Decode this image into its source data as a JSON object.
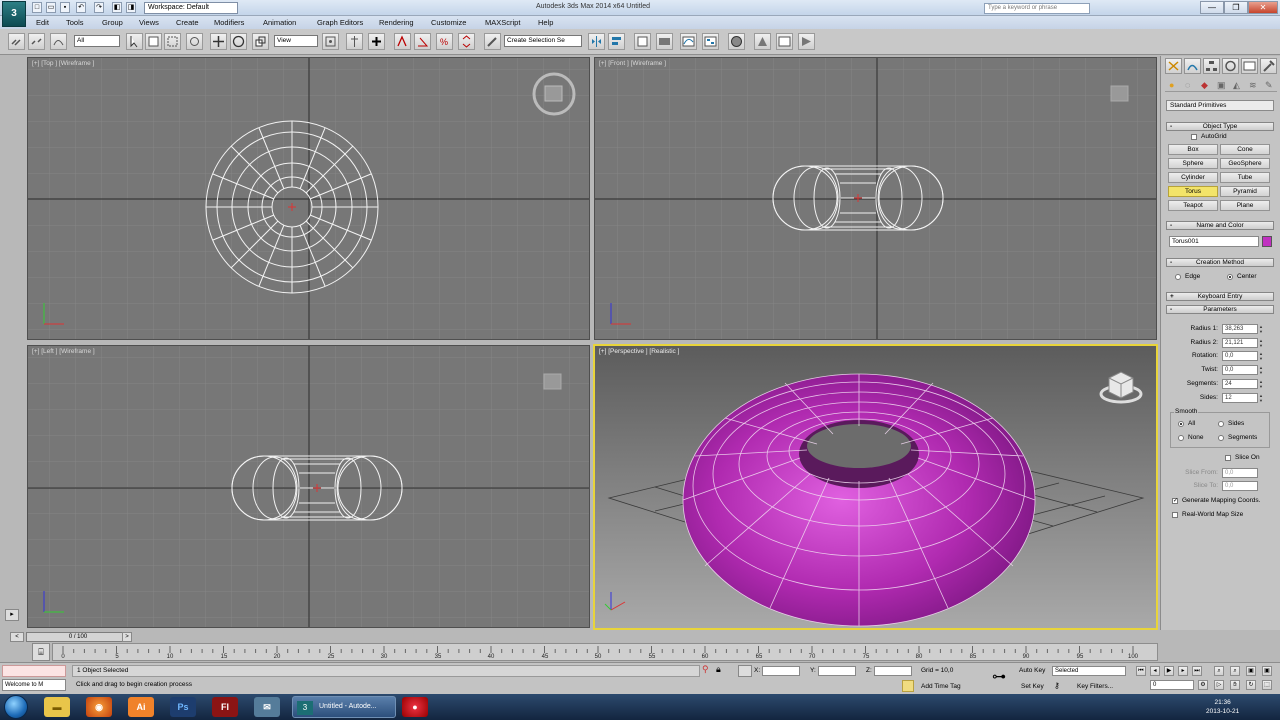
{
  "titlebar": {
    "logo_text": "3",
    "workspace": "Workspace: Default",
    "app_title": "Autodesk 3ds Max  2014 x64     Untitled",
    "search_placeholder": "Type a keyword or phrase",
    "minimize": "—",
    "restore": "❐",
    "close": "✕"
  },
  "menu": [
    "Edit",
    "Tools",
    "Group",
    "Views",
    "Create",
    "Modifiers",
    "Animation",
    "Graph Editors",
    "Rendering",
    "Customize",
    "MAXScript",
    "Help"
  ],
  "toolbar": {
    "filter_select": "All",
    "coord_select": "View",
    "selection_set": "Create Selection Se"
  },
  "viewports": {
    "top": "[+] [Top ] [Wireframe ]",
    "front": "[+] [Front ] [Wireframe ]",
    "left": "[+] [Left ] [Wireframe ]",
    "perspective": "[+] [Perspective ] [Realistic ]"
  },
  "command_panel": {
    "category_select": "Standard Primitives",
    "object_type_title": "Object Type",
    "autogrid": "AutoGrid",
    "objects": [
      "Box",
      "Cone",
      "Sphere",
      "GeoSphere",
      "Cylinder",
      "Tube",
      "Torus",
      "Pyramid",
      "Teapot",
      "Plane"
    ],
    "active_object": "Torus",
    "name_color_title": "Name and Color",
    "object_name": "Torus001",
    "object_color": "#c030c0",
    "creation_method_title": "Creation Method",
    "creation_edge": "Edge",
    "creation_center": "Center",
    "keyboard_entry_title": "Keyboard Entry",
    "parameters_title": "Parameters",
    "params": [
      {
        "label": "Radius 1:",
        "value": "38,263"
      },
      {
        "label": "Radius 2:",
        "value": "21,121"
      },
      {
        "label": "Rotation:",
        "value": "0,0"
      },
      {
        "label": "Twist:",
        "value": "0,0"
      },
      {
        "label": "Segments:",
        "value": "24"
      },
      {
        "label": "Sides:",
        "value": "12"
      }
    ],
    "smooth_title": "Smooth",
    "smooth_all": "All",
    "smooth_sides": "Sides",
    "smooth_none": "None",
    "smooth_segments": "Segments",
    "slice_on": "Slice On",
    "slice_from": "Slice From:",
    "slice_to": "Slice To:",
    "slice_from_value": "0,0",
    "slice_to_value": "0,0",
    "gen_mapping": "Generate Mapping Coords.",
    "real_world": "Real-World Map Size"
  },
  "timeline": {
    "slider": "0 / 100",
    "ticks": [
      "0",
      "5",
      "10",
      "15",
      "20",
      "25",
      "30",
      "35",
      "40",
      "45",
      "50",
      "55",
      "60",
      "65",
      "70",
      "75",
      "80",
      "85",
      "90",
      "95",
      "100"
    ]
  },
  "status": {
    "maxscript": "Welcome to M",
    "selected": "1 Object Selected",
    "prompt": "Click and drag to begin creation process",
    "x_label": "X:",
    "y_label": "Y:",
    "z_label": "Z:",
    "grid": "Grid = 10,0",
    "add_time_tag": "Add Time Tag",
    "auto_key": "Auto Key",
    "set_key": "Set Key",
    "key_mode": "Selected",
    "key_filters": "Key Filters...",
    "frame": "0"
  },
  "taskbar": {
    "active_task": "Untitled - Autode...",
    "time": "21:36",
    "date": "2013-10-21"
  },
  "colors": {
    "viewport_bg": "#777777",
    "grid": "#8a8a8a",
    "axis": "#3a3a3a",
    "active_border": "#e8d43a",
    "torus": "#c030c0"
  }
}
